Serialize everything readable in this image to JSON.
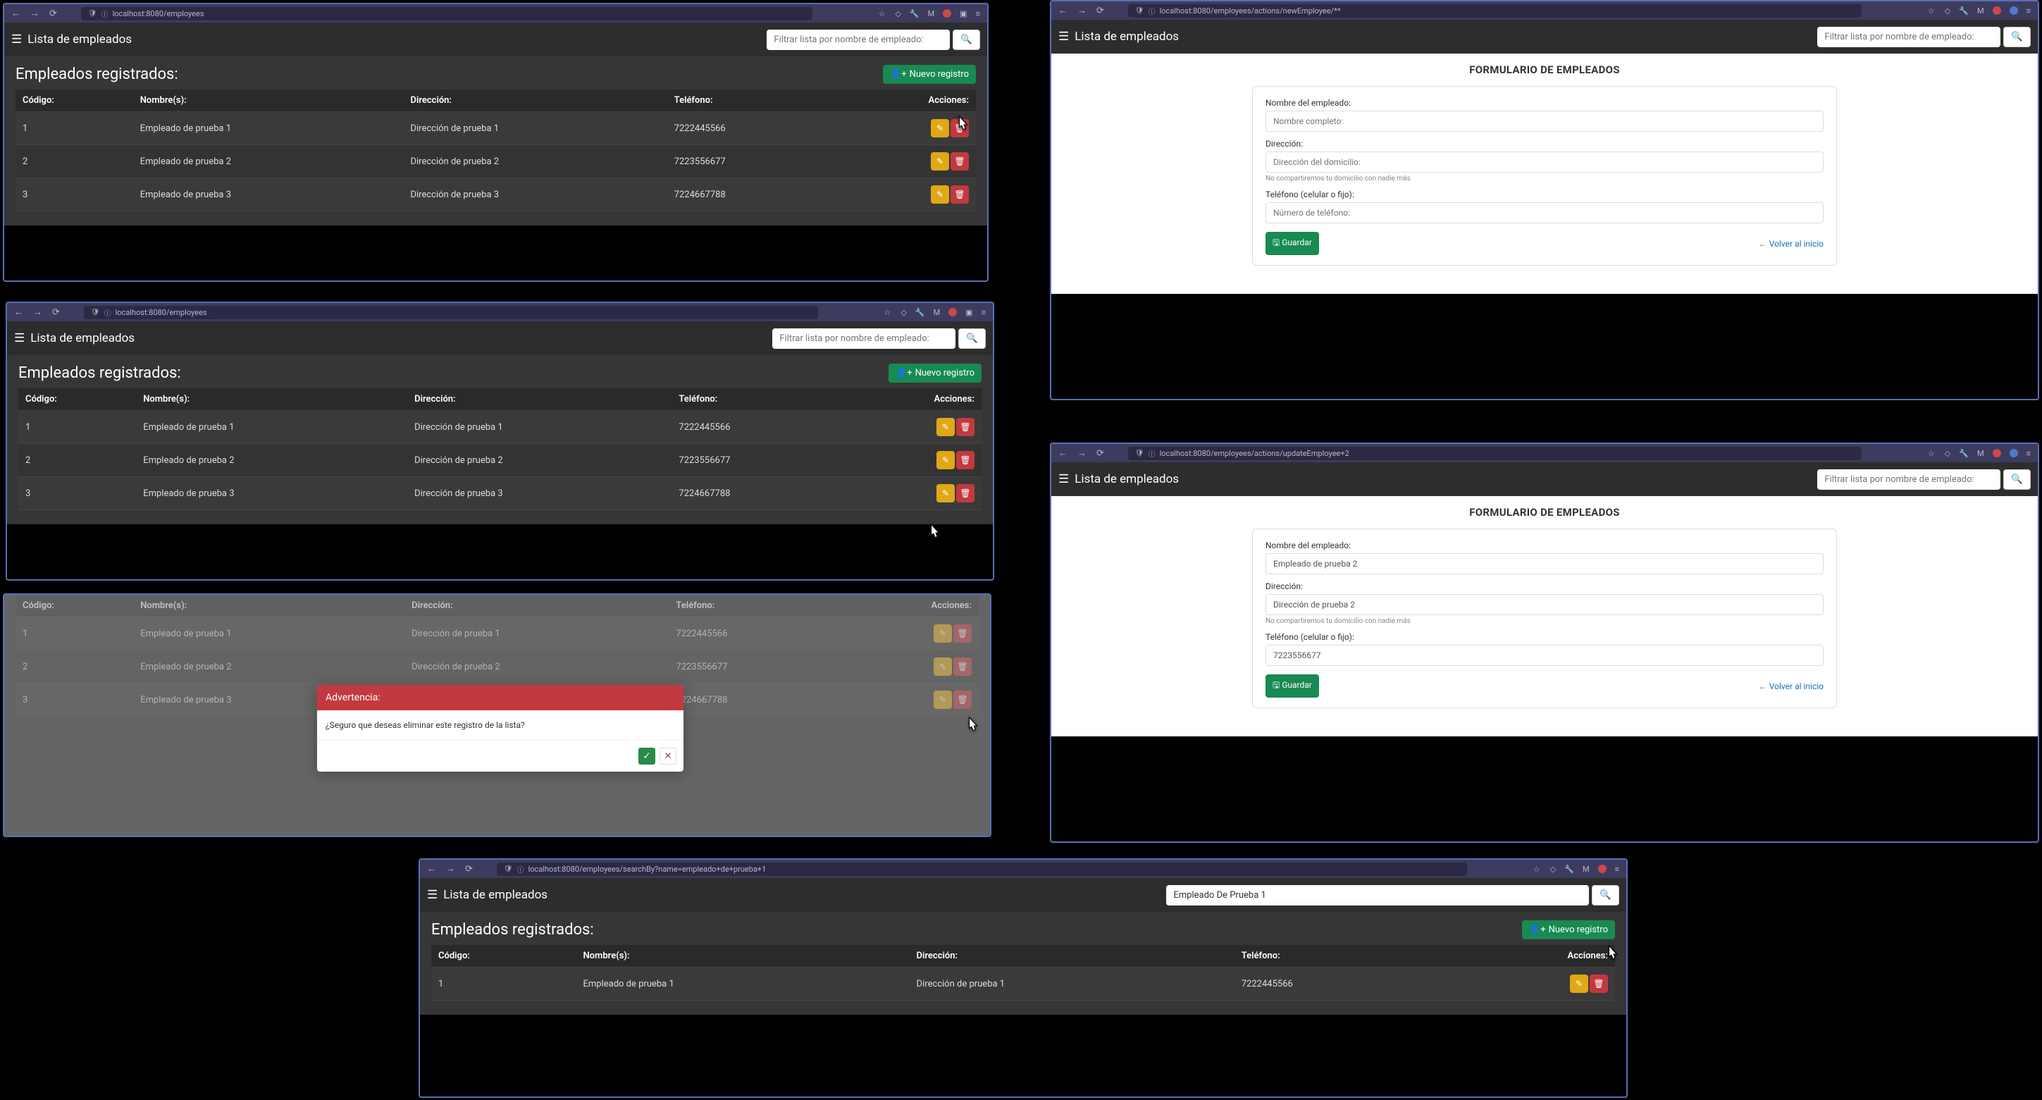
{
  "browser": {
    "url_list": "localhost:8080/employees",
    "url_new": "localhost:8080/employees/actions/newEmployee/**",
    "url_update": "localhost:8080/employees/actions/updateEmployee+2",
    "url_search": "localhost:8080/employees/searchBy?name=empleado+de+prueba+1"
  },
  "app": {
    "title": "Lista de empleados",
    "search_placeholder": "Filtrar lista por nombre de empleado:",
    "search_value": "Empleado De Prueba 1"
  },
  "list": {
    "subtitle": "Empleados registrados:",
    "new_button": "Nuevo registro",
    "headers": {
      "code": "Código:",
      "name": "Nombre(s):",
      "addr": "Dirección:",
      "phone": "Teléfono:",
      "actions": "Acciones:"
    },
    "rows": [
      {
        "id": "1",
        "name": "Empleado de prueba 1",
        "addr": "Dirección de prueba 1",
        "phone": "7222445566"
      },
      {
        "id": "2",
        "name": "Empleado de prueba 2",
        "addr": "Dirección de prueba 2",
        "phone": "7223556677"
      },
      {
        "id": "3",
        "name": "Empleado de prueba 3",
        "addr": "Dirección de prueba 3",
        "phone": "7224667788"
      }
    ],
    "search_rows": [
      {
        "id": "1",
        "name": "Empleado de prueba 1",
        "addr": "Dirección de prueba 1",
        "phone": "7222445566"
      }
    ]
  },
  "modal": {
    "title": "Advertencia:",
    "body": "¿Seguro que deseas eliminar este registro de la lista?"
  },
  "form": {
    "title": "FORMULARIO DE EMPLEADOS",
    "labels": {
      "name": "Nombre del empleado:",
      "addr": "Dirección:",
      "phone": "Teléfono (celular o fijo):"
    },
    "placeholders": {
      "name": "Nombre completo:",
      "addr": "Dirección del domicilio:",
      "phone": "Número de teléfono:"
    },
    "helper_addr": "No compartiremos tu domicilio con nadie más",
    "save": "Guardar",
    "back": "Volver al inicio",
    "values_update": {
      "name": "Empleado de prueba 2",
      "addr": "Dirección de prueba 2",
      "phone": "7223556677"
    }
  }
}
